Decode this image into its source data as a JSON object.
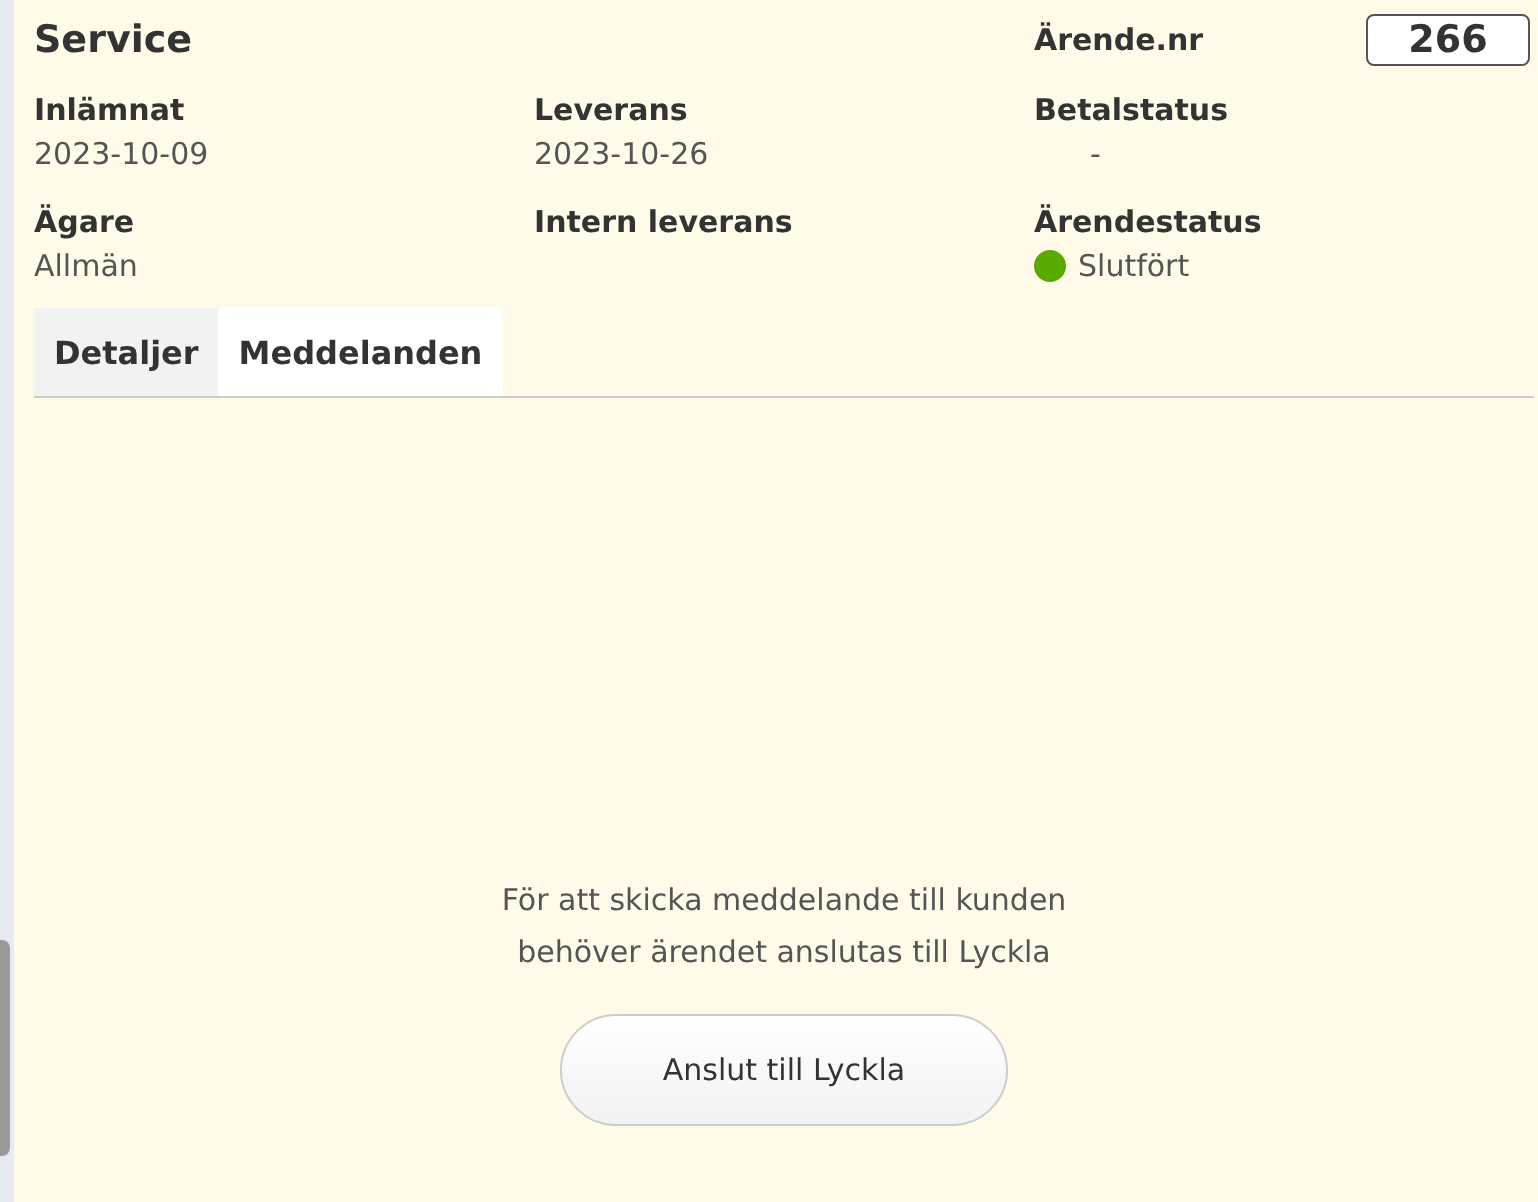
{
  "header": {
    "title": "Service",
    "case_number_label": "Ärende.nr",
    "case_number": "266"
  },
  "fields": [
    {
      "label": "Inlämnat",
      "value": "2023-10-09"
    },
    {
      "label": "Leverans",
      "value": "2023-10-26"
    },
    {
      "label": "Betalstatus",
      "value": "-"
    },
    {
      "label": "Ägare",
      "value": "Allmän"
    },
    {
      "label": "Intern leverans"
    },
    {
      "label": "Ärendestatus",
      "value": "Slutfört",
      "color": "#5aab00"
    }
  ],
  "tabs": [
    {
      "label": "Detaljer",
      "selected": false
    },
    {
      "label": "Meddelanden",
      "selected": true
    }
  ],
  "message": {
    "text": "För att skicka meddelande till kunden\nbehöver ärendet anslutas till Lyckla",
    "button": "Anslut till Lyckla"
  }
}
